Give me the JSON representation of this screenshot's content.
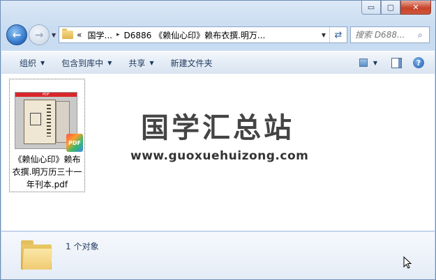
{
  "window": {
    "controls": {
      "minimize": "▭",
      "maximize": "▢",
      "close": "✕"
    }
  },
  "nav": {
    "breadcrumb": {
      "overflow": "«",
      "root": "国学...",
      "separator": "▸",
      "current": "D6886 《赖仙心印》赖布衣撰.明万..."
    },
    "search": {
      "placeholder": "搜索 D688..."
    }
  },
  "toolbar": {
    "organize": "组织",
    "include_in_library": "包含到库中",
    "share": "共享",
    "new_folder": "新建文件夹"
  },
  "content": {
    "files": [
      {
        "name": "《赖仙心印》赖布衣撰.明万历三十一年刊本.pdf",
        "badge": "PDF",
        "thumb_header": "PDF"
      }
    ],
    "watermark": {
      "title": "国学汇总站",
      "url": "www.guoxuehuizong.com"
    }
  },
  "details": {
    "item_count": "1 个对象"
  },
  "colors": {
    "accent": "#1e395b",
    "pdf_red": "#d9262b"
  }
}
